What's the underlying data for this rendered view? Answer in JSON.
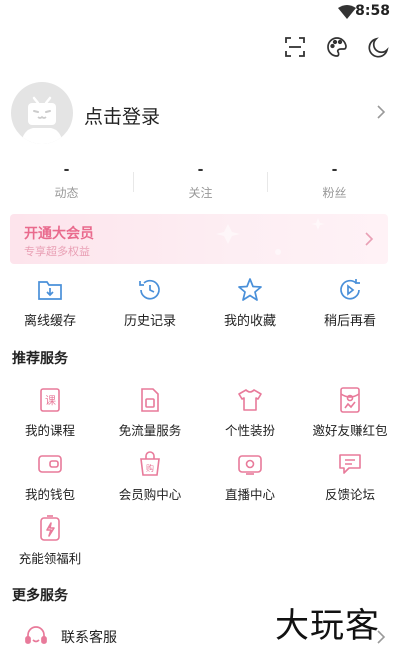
{
  "status": {
    "time": "8:58",
    "wifi_icon": "wifi-icon"
  },
  "top_icons": [
    "scan-icon",
    "palette-icon",
    "moon-icon"
  ],
  "profile": {
    "login_label": "点击登录",
    "avatar_icon": "tv-mascot-icon"
  },
  "stats": [
    {
      "value": "-",
      "label": "动态"
    },
    {
      "value": "-",
      "label": "关注"
    },
    {
      "value": "-",
      "label": "粉丝"
    }
  ],
  "vip": {
    "title": "开通大会员",
    "subtitle": "专享超多权益"
  },
  "quick": [
    {
      "label": "离线缓存",
      "icon": "download-folder-icon"
    },
    {
      "label": "历史记录",
      "icon": "history-clock-icon"
    },
    {
      "label": "我的收藏",
      "icon": "star-icon"
    },
    {
      "label": "稍后再看",
      "icon": "watch-later-icon"
    }
  ],
  "recommended": {
    "title": "推荐服务",
    "items": [
      {
        "label": "我的课程",
        "icon": "course-book-icon"
      },
      {
        "label": "免流量服务",
        "icon": "sim-card-icon"
      },
      {
        "label": "个性装扮",
        "icon": "tshirt-icon"
      },
      {
        "label": "邀好友赚红包",
        "icon": "red-envelope-icon"
      },
      {
        "label": "我的钱包",
        "icon": "wallet-icon"
      },
      {
        "label": "会员购中心",
        "icon": "shopping-bag-icon"
      },
      {
        "label": "直播中心",
        "icon": "live-tv-icon"
      },
      {
        "label": "反馈论坛",
        "icon": "feedback-chat-icon"
      },
      {
        "label": "充能领福利",
        "icon": "energy-battery-icon"
      }
    ]
  },
  "more": {
    "title": "更多服务",
    "items": [
      {
        "label": "联系客服",
        "icon": "headset-icon"
      }
    ]
  },
  "watermark": "大玩客",
  "colors": {
    "accent": "#e96a8d",
    "blue": "#4a90d9",
    "pink": "#e87a9a"
  }
}
